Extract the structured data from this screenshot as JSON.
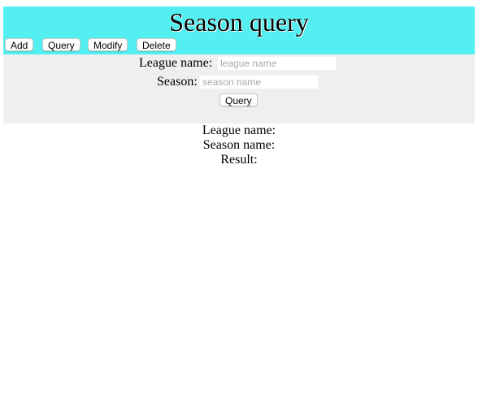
{
  "header": {
    "title": "Season query",
    "background": "#54eff1"
  },
  "nav": {
    "add_label": "Add",
    "query_label": "Query",
    "modify_label": "Modify",
    "delete_label": "Delete"
  },
  "form": {
    "league_label": "League name:",
    "league_placeholder": "league name",
    "league_value": "",
    "season_label": "Season:",
    "season_placeholder": "season name",
    "season_value": "",
    "submit_label": "Query",
    "background": "#efefef"
  },
  "results": {
    "league_label": "League name:",
    "season_label": "Season name:",
    "result_label": "Result:"
  }
}
